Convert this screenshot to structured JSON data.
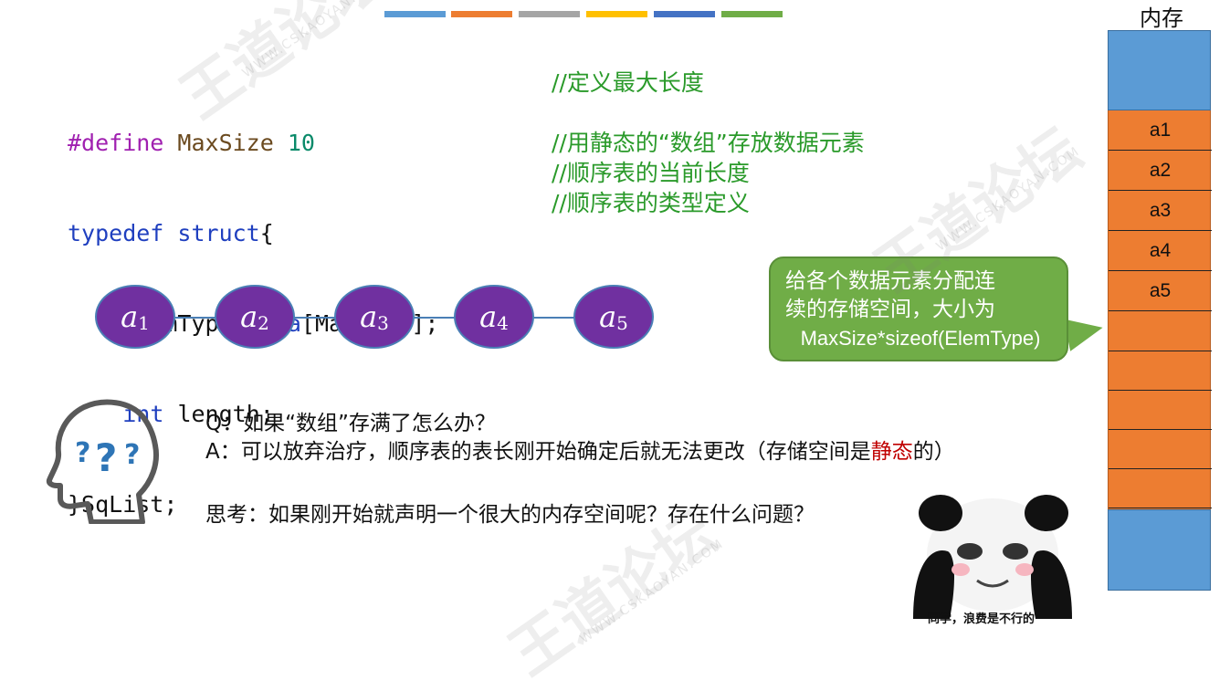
{
  "top_bar_colors": [
    "#5b9bd5",
    "#ed7d31",
    "#a5a5a5",
    "#ffc000",
    "#4472c4",
    "#70ad47"
  ],
  "code": {
    "line1": {
      "kw": "#define",
      "name": "MaxSize",
      "num": "10"
    },
    "line2": {
      "kw1": "typedef",
      "kw2": "struct",
      "brace": "{"
    },
    "line3": {
      "type": "ElemType",
      "field": "data",
      "rest": "[MaxSize];"
    },
    "line4": {
      "type": "int",
      "rest": "length;"
    },
    "line5": {
      "text": "}SqList;"
    }
  },
  "comments": [
    "//定义最大长度",
    "//用静态的“数组”存放数据元素",
    "//顺序表的当前长度",
    "//顺序表的类型定义"
  ],
  "nodes": [
    {
      "base": "a",
      "sub": "1"
    },
    {
      "base": "a",
      "sub": "2"
    },
    {
      "base": "a",
      "sub": "3"
    },
    {
      "base": "a",
      "sub": "4"
    },
    {
      "base": "a",
      "sub": "5"
    }
  ],
  "bubble": {
    "line1": "给各个数据元素分配连",
    "line2": "续的存储空间，大小为",
    "line3": "MaxSize*sizeof(ElemType)"
  },
  "memory": {
    "title": "内存",
    "cells": [
      "a1",
      "a2",
      "a3",
      "a4",
      "a5",
      "",
      "",
      "",
      "",
      ""
    ]
  },
  "qa": {
    "q": "Q：如果“数组”存满了怎么办？",
    "a_prefix": "A：可以放弃治疗，顺序表的表长刚开始确定后就无法更改（存储空间是",
    "a_red": "静态",
    "a_suffix": "的）"
  },
  "think": "思考：如果刚开始就声明一个很大的内存空间呢？存在什么问题？",
  "meme_caption": "同学，浪费是不行的",
  "watermark": {
    "big": "王道论坛",
    "small": "WWW.CSKAOYAN.COM"
  }
}
